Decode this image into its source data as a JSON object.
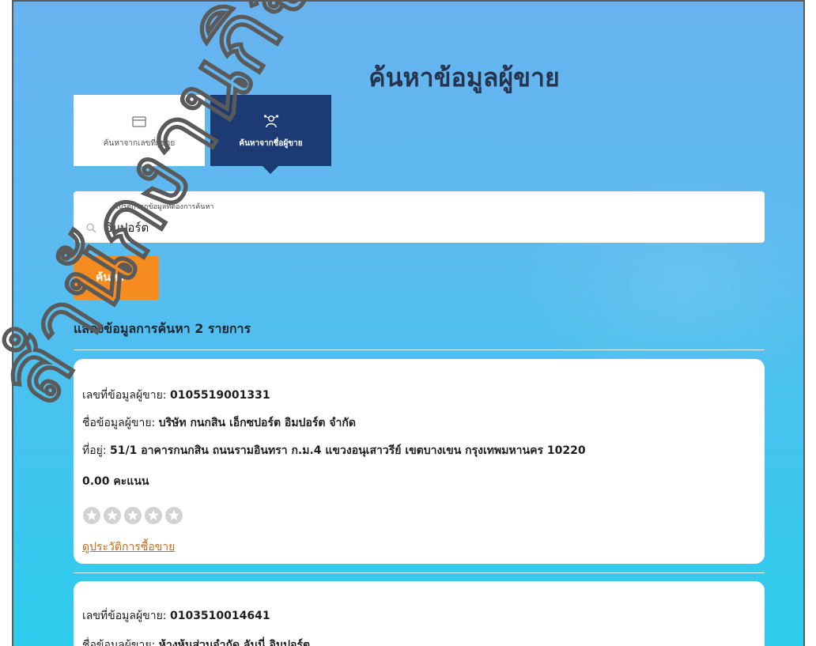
{
  "page": {
    "title": "ค้นหาข้อมูลผู้ขาย"
  },
  "tabs": [
    {
      "label": "ค้นหาจากเลขที่ผู้ขาย",
      "icon": "card-icon",
      "active": false
    },
    {
      "label": "ค้นหาจากชื่อผู้ขาย",
      "icon": "user-network-icon",
      "active": true
    }
  ],
  "search": {
    "hint": "โปรดกรอกข้อมูลที่ต้องการค้นหา",
    "value": "อิมปอร์ต",
    "button_label": "ค้นหา"
  },
  "results": {
    "summary": "แสดงข้อมูลการค้นหา 2 รายการ",
    "items": [
      {
        "id_label": "เลขที่ข้อมูลผู้ขาย:",
        "id_value": "0105519001331",
        "name_label": "ชื่อข้อมูลผู้ขาย:",
        "name_value": "บริษัท กนกสิน เอ็กซปอร์ต อิมปอร์ต จำกัด",
        "address_label": "ที่อยู่:",
        "address_value": "51/1 อาคารกนกสิน ถนนรามอินทรา ก.ม.4 แขวงอนุเสาวรีย์ เขตบางเขน กรุงเทพมหานคร 10220",
        "score": "0.00 คะแนน",
        "rating": 0,
        "rating_max": 5,
        "history_link": "ดูประวัติการซื้อขาย"
      },
      {
        "id_label": "เลขที่ข้อมูลผู้ขาย:",
        "id_value": "0103510014641",
        "name_label": "ชื่อข้อมูลผู้ขาย:",
        "name_value": "ห้างหุ้นส่วนจำกัด ลันนี่ อิมปอร์ต"
      }
    ]
  },
  "watermark": {
    "text": "สำนักงานกิจกรรม",
    "color": "#5a5a5a"
  },
  "colors": {
    "active_tab": "#1c3a74",
    "search_button": "#f68b1f",
    "link": "#c86a1a",
    "title": "#27344e"
  }
}
